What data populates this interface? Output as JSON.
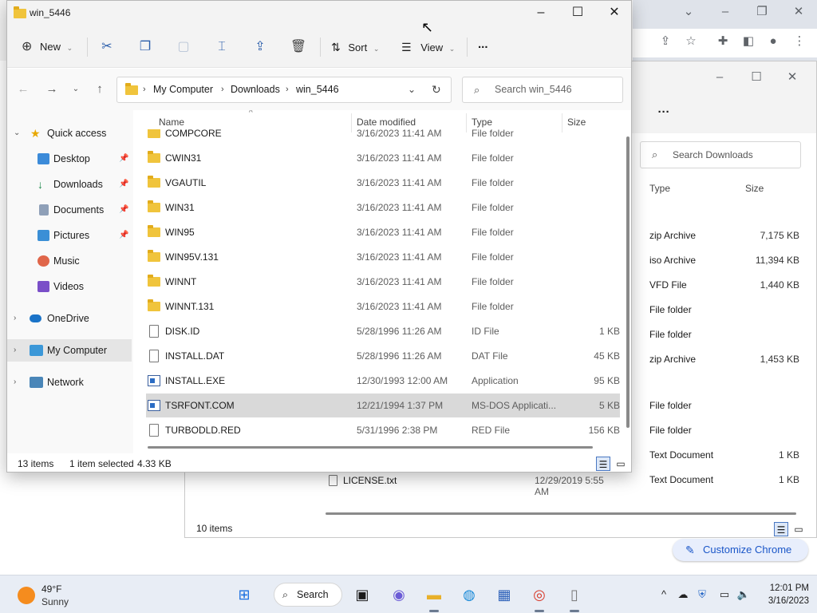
{
  "chrome": {
    "customize_label": "Customize Chrome"
  },
  "downloads_window": {
    "search_placeholder": "Search Downloads",
    "col_type": "Type",
    "col_size": "Size",
    "rows": [
      {
        "type": "zip Archive",
        "size": "7,175 KB"
      },
      {
        "type": "iso Archive",
        "size": "11,394 KB"
      },
      {
        "type": "VFD File",
        "size": "1,440 KB"
      },
      {
        "type": "File folder",
        "size": ""
      },
      {
        "type": "File folder",
        "size": ""
      },
      {
        "type": "zip Archive",
        "size": "1,453 KB"
      },
      {
        "type": "File folder",
        "size": ""
      },
      {
        "type": "File folder",
        "size": ""
      },
      {
        "type": "Text Document",
        "size": "1 KB"
      },
      {
        "type": "Text Document",
        "size": "1 KB"
      }
    ],
    "license_name": "LICENSE.txt",
    "license_date": "12/29/2019 5:55 AM",
    "item_count": "10 items"
  },
  "window": {
    "title": "win_5446",
    "toolbar": {
      "new": "New",
      "sort": "Sort",
      "view": "View",
      "more": "..."
    },
    "breadcrumb": [
      "My Computer",
      "Downloads",
      "win_5446"
    ],
    "search_placeholder": "Search win_5446",
    "nav": {
      "quick_access": "Quick access",
      "desktop": "Desktop",
      "downloads": "Downloads",
      "documents": "Documents",
      "pictures": "Pictures",
      "music": "Music",
      "videos": "Videos",
      "onedrive": "OneDrive",
      "my_computer": "My Computer",
      "network": "Network"
    },
    "columns": {
      "name": "Name",
      "date": "Date modified",
      "type": "Type",
      "size": "Size"
    },
    "files": [
      {
        "name": "COMPCORE",
        "date": "3/16/2023 11:41 AM",
        "type": "File folder",
        "size": "",
        "icon": "folder"
      },
      {
        "name": "CWIN31",
        "date": "3/16/2023 11:41 AM",
        "type": "File folder",
        "size": "",
        "icon": "folder"
      },
      {
        "name": "VGAUTIL",
        "date": "3/16/2023 11:41 AM",
        "type": "File folder",
        "size": "",
        "icon": "folder"
      },
      {
        "name": "WIN31",
        "date": "3/16/2023 11:41 AM",
        "type": "File folder",
        "size": "",
        "icon": "folder"
      },
      {
        "name": "WIN95",
        "date": "3/16/2023 11:41 AM",
        "type": "File folder",
        "size": "",
        "icon": "folder"
      },
      {
        "name": "WIN95V.131",
        "date": "3/16/2023 11:41 AM",
        "type": "File folder",
        "size": "",
        "icon": "folder"
      },
      {
        "name": "WINNT",
        "date": "3/16/2023 11:41 AM",
        "type": "File folder",
        "size": "",
        "icon": "folder"
      },
      {
        "name": "WINNT.131",
        "date": "3/16/2023 11:41 AM",
        "type": "File folder",
        "size": "",
        "icon": "folder"
      },
      {
        "name": "DISK.ID",
        "date": "5/28/1996 11:26 AM",
        "type": "ID File",
        "size": "1 KB",
        "icon": "document"
      },
      {
        "name": "INSTALL.DAT",
        "date": "5/28/1996 11:26 AM",
        "type": "DAT File",
        "size": "45 KB",
        "icon": "document"
      },
      {
        "name": "INSTALL.EXE",
        "date": "12/30/1993 12:00 AM",
        "type": "Application",
        "size": "95 KB",
        "icon": "application"
      },
      {
        "name": "TSRFONT.COM",
        "date": "12/21/1994 1:37 PM",
        "type": "MS-DOS Applicati...",
        "size": "5 KB",
        "icon": "application"
      },
      {
        "name": "TURBODLD.RED",
        "date": "5/31/1996 2:38 PM",
        "type": "RED File",
        "size": "156 KB",
        "icon": "document"
      }
    ],
    "status": {
      "count": "13 items",
      "selected": "1 item selected",
      "size": "4.33 KB"
    }
  },
  "taskbar": {
    "weather_temp": "49°F",
    "weather_cond": "Sunny",
    "search_label": "Search",
    "time": "12:01 PM",
    "date": "3/16/2023"
  },
  "colors": {
    "accent": "#0067c0",
    "folder": "#f0c43c",
    "selection": "#d9d9d9"
  }
}
